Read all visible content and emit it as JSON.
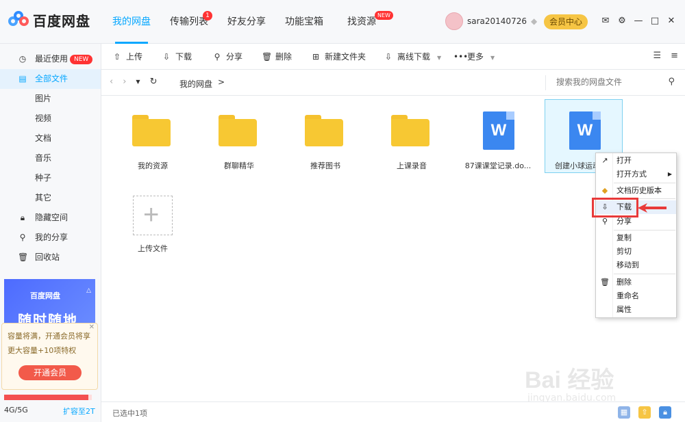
{
  "app": {
    "name": "百度网盘"
  },
  "nav": {
    "tabs": [
      {
        "label": "我的网盘"
      },
      {
        "label": "传输列表",
        "badge": "1"
      },
      {
        "label": "好友分享"
      },
      {
        "label": "功能宝箱"
      },
      {
        "label": "找资源",
        "badge": "NEW"
      }
    ]
  },
  "user": {
    "name": "sara20140726",
    "vip_button": "会员中心"
  },
  "sidebar": {
    "items": [
      {
        "label": "最近使用",
        "badge": "NEW"
      },
      {
        "label": "全部文件"
      },
      {
        "label": "图片"
      },
      {
        "label": "视频"
      },
      {
        "label": "文档"
      },
      {
        "label": "音乐"
      },
      {
        "label": "种子"
      },
      {
        "label": "其它"
      },
      {
        "label": "隐藏空间"
      },
      {
        "label": "我的分享"
      },
      {
        "label": "回收站"
      }
    ],
    "banner": {
      "brand": "百度网盘",
      "title": "随时随地"
    },
    "tip": {
      "text": "容量将满，开通会员将享更大容量+10项特权",
      "button": "开通会员"
    },
    "quota": {
      "used_text": "4G/5G",
      "upgrade_link": "扩容至2T",
      "used_fraction": 0.96
    }
  },
  "toolbar": {
    "upload": "上传",
    "download": "下载",
    "share": "分享",
    "delete": "删除",
    "new_folder": "新建文件夹",
    "offline_download": "离线下载",
    "more": "更多"
  },
  "breadcrumb": {
    "root": "我的网盘",
    "sep": ">"
  },
  "search": {
    "placeholder": "搜索我的网盘文件"
  },
  "files": [
    {
      "name": "我的资源",
      "type": "folder"
    },
    {
      "name": "群聊精华",
      "type": "folder"
    },
    {
      "name": "推荐图书",
      "type": "folder"
    },
    {
      "name": "上课录音",
      "type": "folder"
    },
    {
      "name": "87课课堂记录.do...",
      "type": "word"
    },
    {
      "name": "创建小球运动",
      "type": "word",
      "selected": true
    }
  ],
  "upload_tile": {
    "label": "上传文件"
  },
  "context_menu": {
    "items": [
      {
        "label": "打开"
      },
      {
        "label": "打开方式"
      },
      {
        "label": "文档历史版本"
      },
      {
        "label": "下载"
      },
      {
        "label": "分享"
      },
      {
        "label": "复制"
      },
      {
        "label": "剪切"
      },
      {
        "label": "移动到"
      },
      {
        "label": "删除"
      },
      {
        "label": "重命名"
      },
      {
        "label": "属性"
      }
    ]
  },
  "status": {
    "selected_text": "已选中1项"
  },
  "watermark": {
    "brand": "Bai 经验",
    "url": "jingyan.baidu.com"
  },
  "colors": {
    "accent": "#06a7ff",
    "folder": "#f7c833",
    "word": "#3b87f0",
    "highlight_red": "#e83a3a"
  }
}
